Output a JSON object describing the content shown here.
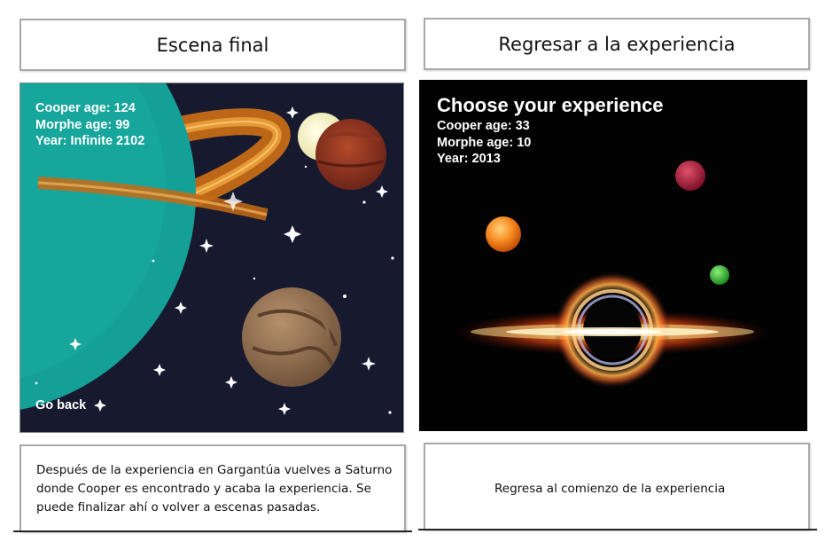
{
  "left": {
    "title": "Escena final",
    "hud": {
      "cooper_age": "Cooper age: 124",
      "morphe_age": "Morphe age: 99",
      "year": "Year: Infinite 2102"
    },
    "go_back": "Go back",
    "description": "Después de la experiencia en Gargantúa vuelves a Saturno donde Cooper es encontrado y acaba la experiencia. Se puede finalizar ahí o volver a escenas pasadas."
  },
  "right": {
    "title": "Regresar a la experiencia",
    "hud": {
      "heading": "Choose your experience",
      "cooper_age": "Cooper age: 33",
      "morphe_age": "Morphe age: 10",
      "year": "Year: 2013"
    },
    "description": "Regresa al comienzo de la experiencia"
  },
  "icons": [
    "saturn-planet",
    "moon-icon",
    "mars-planet-icon",
    "brown-planet-icon",
    "star-icon",
    "orange-planet-icon",
    "red-planet-icon",
    "green-planet-icon",
    "black-hole-icon"
  ],
  "colors": {
    "left_space_bg": "#171a2f",
    "right_space_bg": "#020203",
    "saturn_teal": "#14a097",
    "saturn_ring": "#d7861a"
  }
}
